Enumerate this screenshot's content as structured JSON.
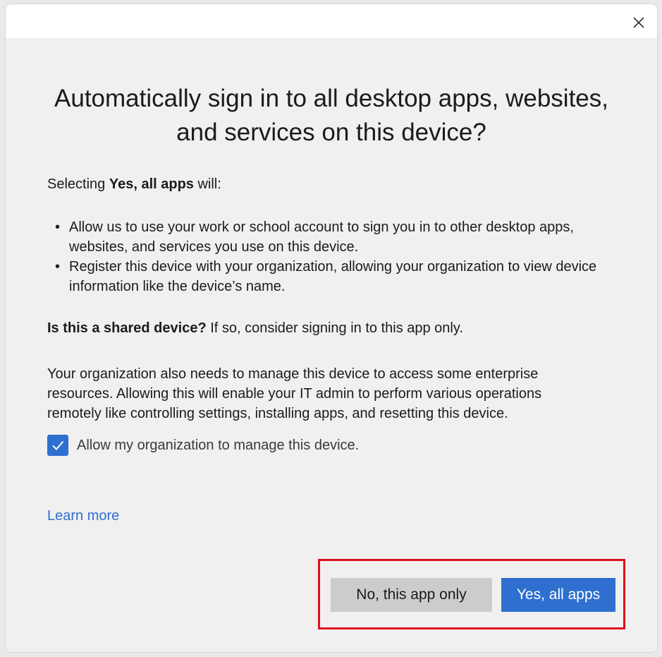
{
  "dialog": {
    "close_icon": "close-icon",
    "heading": "Automatically sign in to all desktop apps, websites, and services on this device?",
    "intro_prefix": "Selecting ",
    "intro_bold": "Yes, all apps",
    "intro_suffix": " will:",
    "bullets": [
      "Allow us to use your work or school account to sign you in to other desktop apps, websites, and services you use on this device.",
      "Register this device with your organization, allowing your organization to view device information like the device’s name."
    ],
    "shared_bold": "Is this a shared device?",
    "shared_text": " If so, consider signing in to this app only.",
    "manage_text": "Your organization also needs to manage this device to access some enterprise resources. Allowing this will enable your IT admin to perform various operations remotely like controlling settings, installing apps, and resetting this device.",
    "checkbox": {
      "checked": true,
      "label": "Allow my organization to manage this device."
    },
    "learn_more": "Learn more",
    "buttons": {
      "secondary": "No, this app only",
      "primary": "Yes, all apps"
    },
    "colors": {
      "accent": "#2e6fd0",
      "highlight": "#e0101e",
      "link": "#2f6fcf"
    }
  }
}
